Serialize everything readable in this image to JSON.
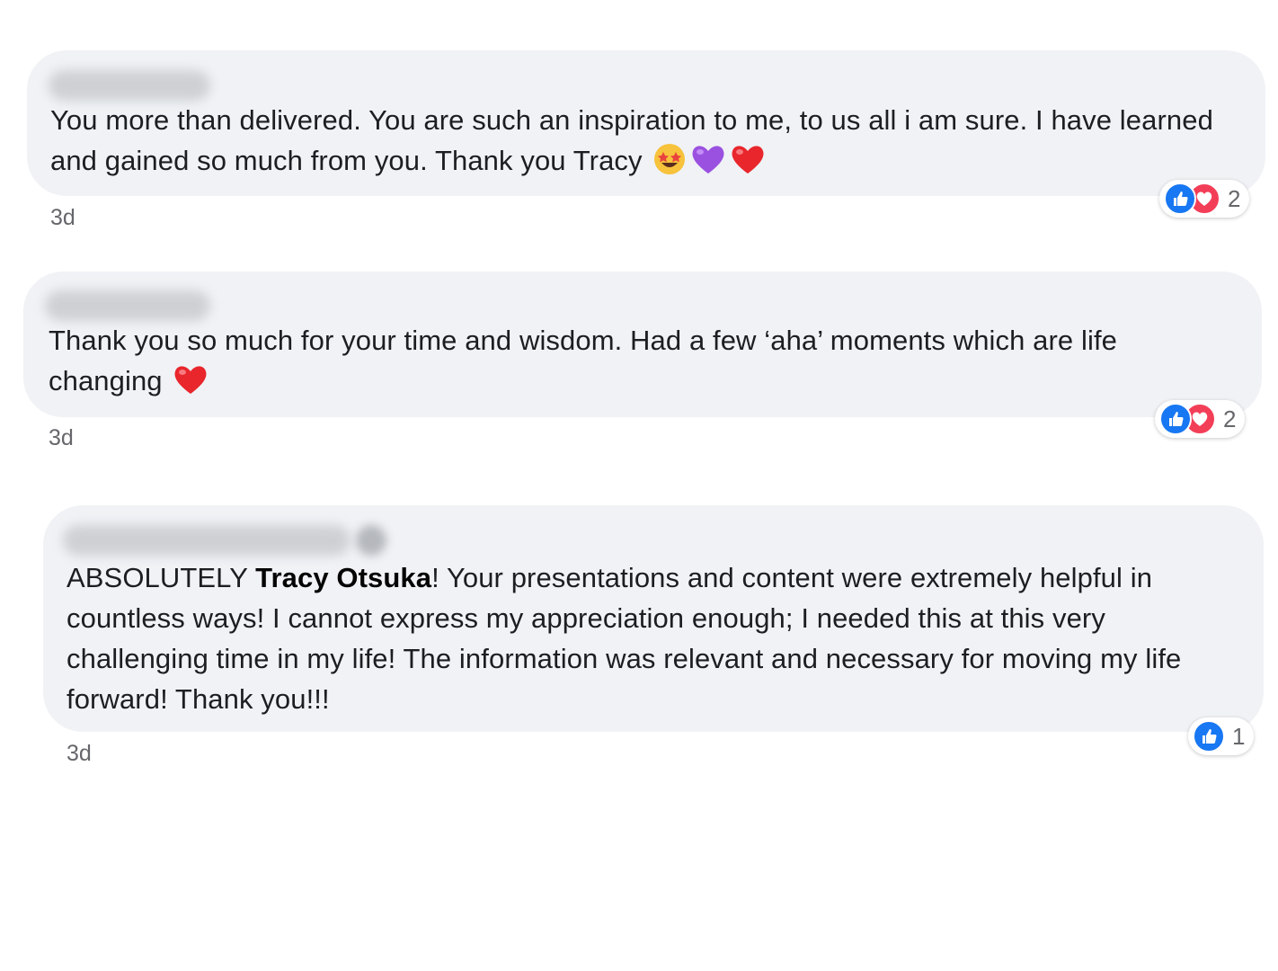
{
  "comments": [
    {
      "text": "You more than delivered. You are such an inspiration to me, to us all i am sure. I have learned and gained so much from you. Thank you Tracy",
      "emojis": [
        "star-struck-emoji",
        "purple-heart-emoji",
        "red-heart-emoji"
      ],
      "timestamp": "3d",
      "reactions": [
        "like-icon",
        "love-icon"
      ],
      "reaction_count": "2"
    },
    {
      "text": "Thank you so much for your time and wisdom. Had a few ‘aha’ moments which are life changing",
      "emojis": [
        "red-heart-emoji"
      ],
      "timestamp": "3d",
      "reactions": [
        "like-icon",
        "love-icon"
      ],
      "reaction_count": "2"
    },
    {
      "text_before": "ABSOLUTELY ",
      "mention": "Tracy Otsuka",
      "text_after": "! Your presentations and content were extremely helpful in countless ways! I cannot express my appreciation enough; I needed this at this very challenging time in my life! The information was relevant and necessary for moving my life forward! Thank you!!!",
      "timestamp": "3d",
      "reactions": [
        "like-icon"
      ],
      "reaction_count": "1"
    }
  ],
  "colors": {
    "bubble": "#f0f2f5",
    "like": "#1877f2",
    "love": "#f33e58",
    "meta_text": "#65676b"
  }
}
